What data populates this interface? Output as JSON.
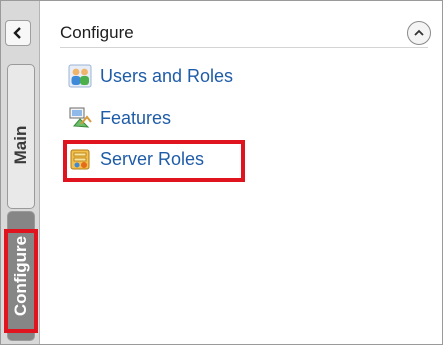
{
  "sidebar": {
    "tabs": [
      {
        "label": "Main",
        "selected": false
      },
      {
        "label": "Configure",
        "selected": true
      }
    ],
    "collapse_icon": "chevron-left-icon"
  },
  "panel": {
    "title": "Configure",
    "collapse_icon": "chevron-up-circle-icon",
    "items": [
      {
        "label": "Users and Roles",
        "icon": "users-roles-icon"
      },
      {
        "label": "Features",
        "icon": "features-icon"
      },
      {
        "label": "Server Roles",
        "icon": "server-roles-icon",
        "highlighted": true
      }
    ]
  },
  "colors": {
    "link": "#1f5ca8",
    "highlight": "#e0141e",
    "selected_tab": "#868686"
  }
}
